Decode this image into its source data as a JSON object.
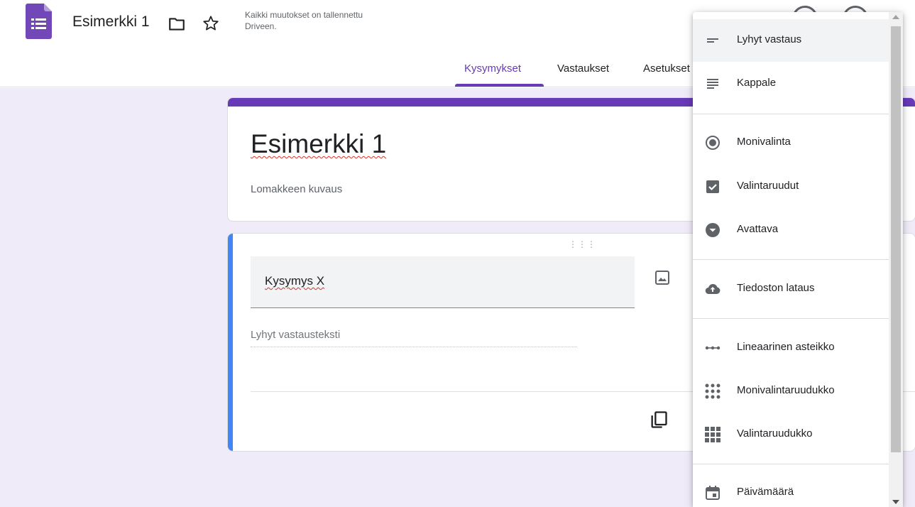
{
  "header": {
    "title": "Esimerkki 1",
    "save_status": "Kaikki muutokset on tallennettu Driveen."
  },
  "tabs": [
    {
      "label": "Kysymykset",
      "active": true
    },
    {
      "label": "Vastaukset",
      "active": false
    },
    {
      "label": "Asetukset",
      "active": false
    }
  ],
  "form": {
    "title": "Esimerkki 1",
    "description": "Lomakkeen kuvaus"
  },
  "question": {
    "text": "Kysymys X",
    "answer_placeholder": "Lyhyt vastausteksti"
  },
  "menu": {
    "items": [
      {
        "label": "Lyhyt vastaus",
        "icon": "short-answer-icon"
      },
      {
        "label": "Kappale",
        "icon": "paragraph-icon"
      },
      {
        "label": "Monivalinta",
        "icon": "radio-icon"
      },
      {
        "label": "Valintaruudut",
        "icon": "checkbox-icon"
      },
      {
        "label": "Avattava",
        "icon": "dropdown-icon"
      },
      {
        "label": "Tiedoston lataus",
        "icon": "cloud-upload-icon"
      },
      {
        "label": "Lineaarinen asteikko",
        "icon": "linear-scale-icon"
      },
      {
        "label": "Monivalintaruudukko",
        "icon": "multiple-choice-grid-icon"
      },
      {
        "label": "Valintaruudukko",
        "icon": "checkbox-grid-icon"
      },
      {
        "label": "Päivämäärä",
        "icon": "calendar-icon"
      }
    ]
  },
  "colors": {
    "brand": "#673ab7",
    "accent_blue": "#4285f4",
    "canvas_bg": "#f0ebf8"
  }
}
